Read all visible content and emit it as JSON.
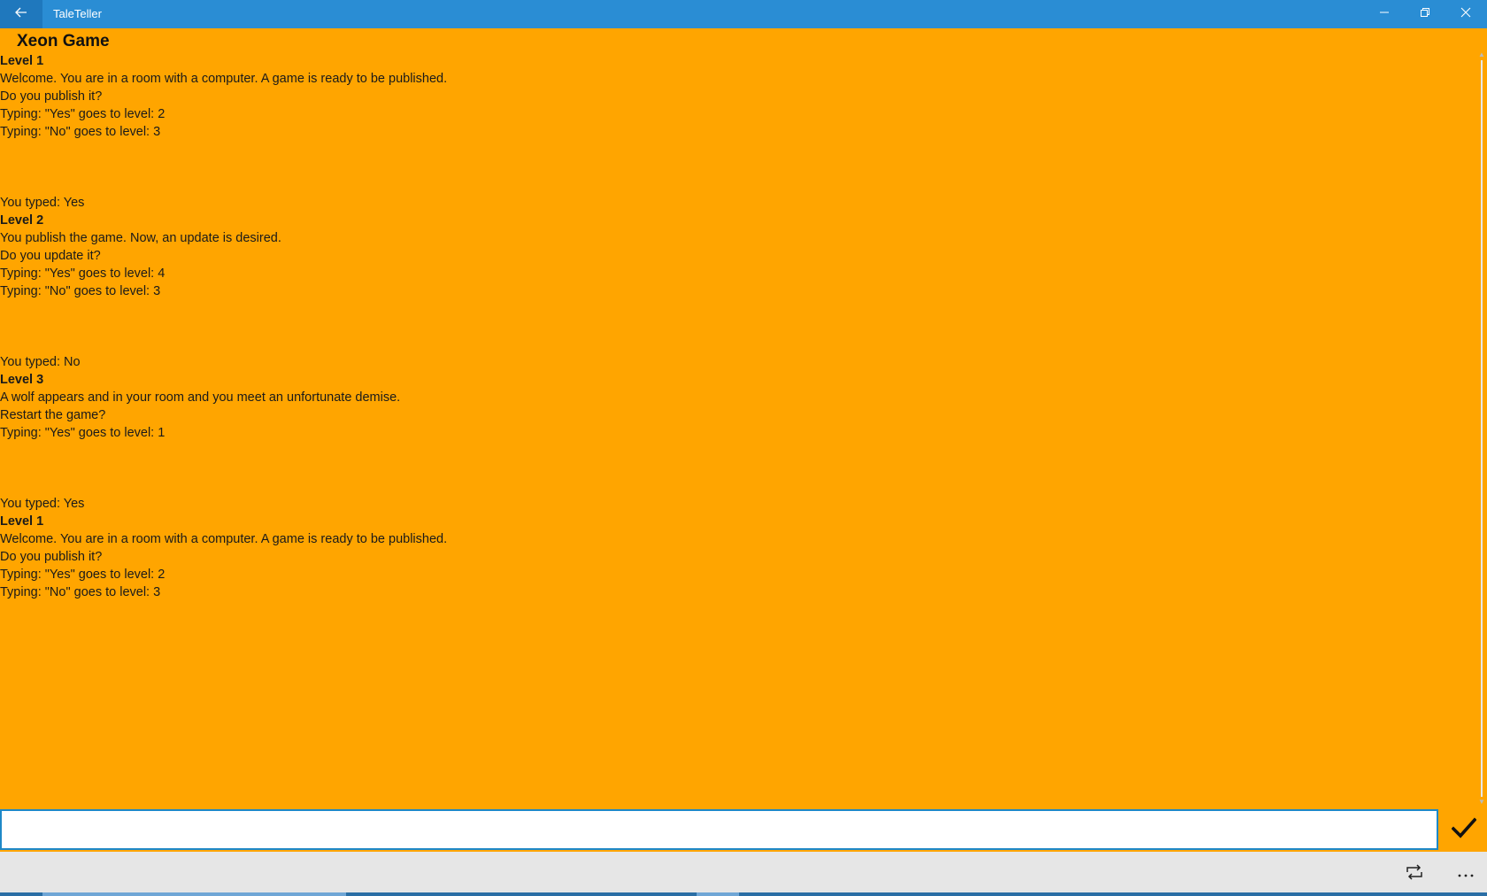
{
  "window": {
    "title": "TaleTeller",
    "back_icon": "back-arrow-icon",
    "minimize_icon": "minimize-icon",
    "restore_icon": "restore-icon",
    "close_icon": "close-icon"
  },
  "game": {
    "title": "Xeon Game",
    "lines": [
      {
        "text": "Level 1",
        "bold": true
      },
      {
        "text": "Welcome. You are in a room with a computer. A game is ready to be published."
      },
      {
        "text": "Do you publish it?"
      },
      {
        "text": "Typing: \"Yes\" goes to level: 2"
      },
      {
        "text": "Typing: \"No\" goes to level: 3"
      },
      {
        "text": "",
        "gap": true
      },
      {
        "text": "You typed: Yes"
      },
      {
        "text": "Level 2",
        "bold": true
      },
      {
        "text": "You publish the game. Now, an update is desired."
      },
      {
        "text": "Do you update it?"
      },
      {
        "text": "Typing: \"Yes\" goes to level: 4"
      },
      {
        "text": "Typing: \"No\" goes to level: 3"
      },
      {
        "text": "",
        "gap": true
      },
      {
        "text": "You typed: No"
      },
      {
        "text": "Level 3",
        "bold": true
      },
      {
        "text": "A wolf appears and in your room and you meet an unfortunate demise."
      },
      {
        "text": "Restart the game?"
      },
      {
        "text": "Typing: \"Yes\" goes to level: 1"
      },
      {
        "text": "",
        "gap": true
      },
      {
        "text": "You typed: Yes"
      },
      {
        "text": "Level 1",
        "bold": true
      },
      {
        "text": "Welcome. You are in a room with a computer. A game is ready to be published."
      },
      {
        "text": "Do you publish it?"
      },
      {
        "text": "Typing: \"Yes\" goes to level: 2"
      },
      {
        "text": "Typing: \"No\" goes to level: 3"
      }
    ]
  },
  "input": {
    "value": "",
    "placeholder": "",
    "submit_icon": "checkmark-icon"
  },
  "appbar": {
    "repeat_icon": "repeat-icon",
    "more_icon": "more-icon"
  },
  "colors": {
    "titlebar": "#2a8dd4",
    "content_background": "#ffa500",
    "input_border": "#1e88c7",
    "appbar": "#e6e6e6"
  }
}
